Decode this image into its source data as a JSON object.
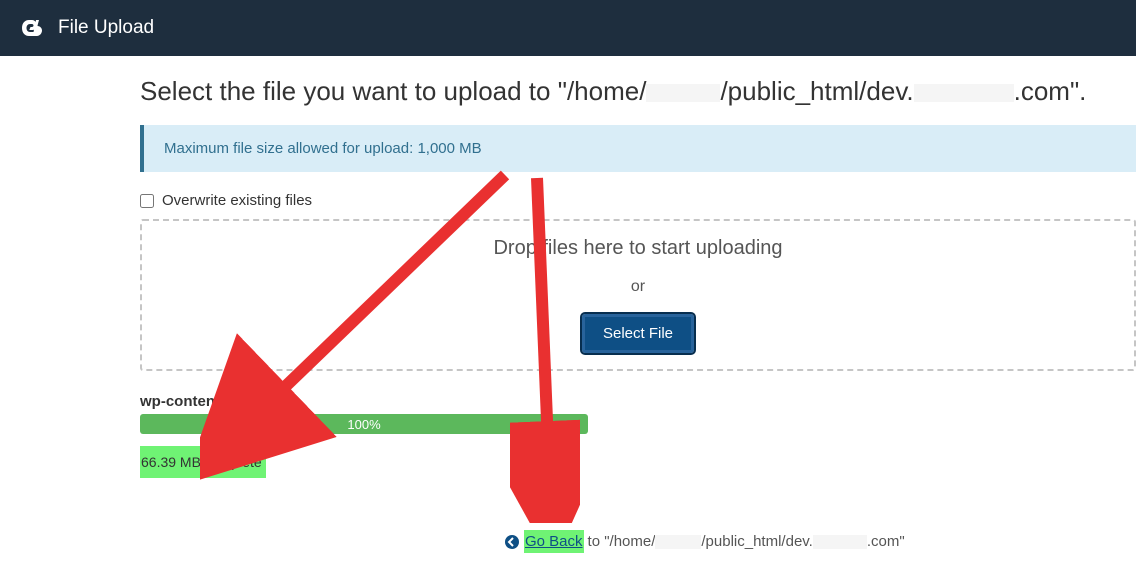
{
  "topbar": {
    "title": "File Upload"
  },
  "heading": {
    "prefix": "Select the file you want to upload to \"/home/",
    "mid": "/public_html/dev.",
    "suffix": ".com\"."
  },
  "banner": {
    "text": "Maximum file size allowed for upload: 1,000 MB"
  },
  "overwrite": {
    "label": "Overwrite existing files"
  },
  "dropzone": {
    "drop_text": "Drop files here to start uploading",
    "or_text": "or",
    "select_label": "Select File"
  },
  "upload": {
    "filename": "wp-content.zip",
    "percent": "100%",
    "status": "66.39 MB complete"
  },
  "goback": {
    "link": "Go Back",
    "to": " to \"/home/",
    "mid": "/public_html/dev.",
    "suffix": ".com\""
  }
}
